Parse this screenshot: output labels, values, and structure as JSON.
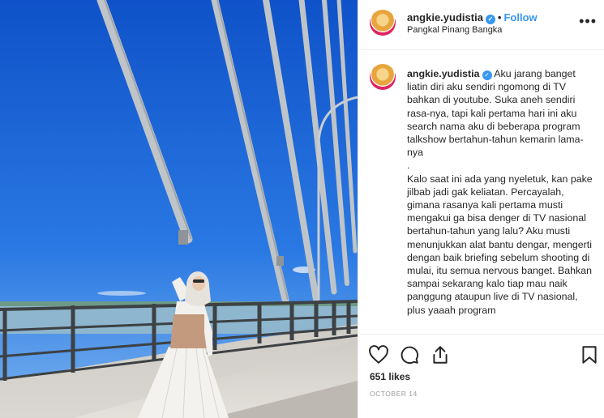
{
  "post": {
    "username": "angkie.yudistia",
    "follow_label": "Follow",
    "separator": "•",
    "location": "Pangkal Pinang Bangka",
    "more_label": "•••"
  },
  "caption": {
    "username": "angkie.yudistia",
    "text": "Aku jarang banget liatin diri aku sendiri ngomong di TV bahkan di youtube. Suka aneh sendiri rasa-nya, tapi kali pertama hari ini aku search nama aku di beberapa program talkshow bertahun-tahun kemarin lama-nya\n.\nKalo saat ini ada yang nyeletuk, kan pake jilbab jadi gak keliatan. Percayalah, gimana rasanya kali pertama musti mengakui ga bisa denger di TV nasional bertahun-tahun yang lalu? Aku musti menunjukkan alat bantu dengar, mengerti dengan baik briefing sebelum shooting di mulai, itu semua nervous banget. Bahkan sampai sekarang kalo tiap mau naik panggung ataupun live di TV nasional, plus yaaah program"
  },
  "actions": {
    "likes": "651 likes",
    "date": "October 14",
    "icons": [
      "heart-icon",
      "comment-icon",
      "share-icon",
      "bookmark-icon"
    ]
  },
  "colors": {
    "accent": "#3897f0",
    "text": "#262626",
    "muted": "#999999",
    "sky": "#1a63d6"
  }
}
